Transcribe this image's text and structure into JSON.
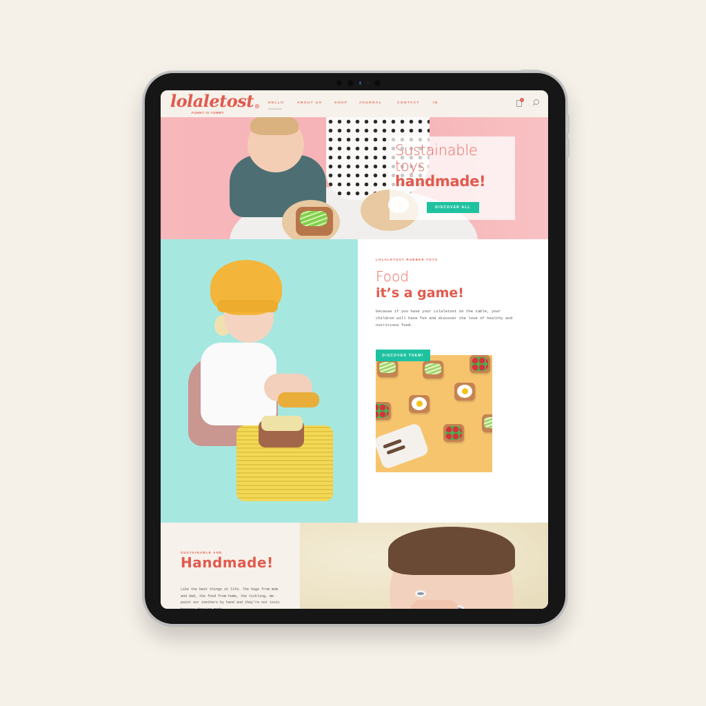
{
  "header": {
    "logo": "lolaletost",
    "logo_mark": "®",
    "tagline": "FUNNY IS YUMMY",
    "nav": [
      {
        "label": "HELLO",
        "active": true
      },
      {
        "label": "ABOUT US",
        "active": false
      },
      {
        "label": "SHOP",
        "active": false
      },
      {
        "label": "JOURNAL",
        "active": false
      },
      {
        "label": "CONTACT",
        "active": false
      },
      {
        "label": "IN",
        "active": false
      }
    ],
    "cart_count": "0",
    "icons": {
      "cart": "shopping-bag-icon",
      "search": "search-icon"
    }
  },
  "hero": {
    "line1": "Sustainable",
    "line2": "toys",
    "line3": "handmade!",
    "button": "DISCOVER ALL"
  },
  "food_section": {
    "eyebrow": "LOLALETOST RUBBER TOYS",
    "title_light": "Food",
    "title_bold": "it’s a game!",
    "body": "because if you have your Lolaletost on the table, your children will have fun and discover the love of healthy and nutritious food.",
    "button": "DISCOVER THEM!"
  },
  "handmade_section": {
    "eyebrow": "SUSTAINABLE AND",
    "title": "Handmade!",
    "body": "Like the best things in life. The hugs from mom and dad, the food from home, the tickling… We paint our teethers by hand and they're not toxic because they're made"
  },
  "colors": {
    "brand": "#e25a4e",
    "accent": "#1fc2a0",
    "background": "#f5f0e8",
    "hero_pink": "#f6b2b6",
    "mint": "#a6e7e0",
    "mustard": "#f7c46e"
  }
}
